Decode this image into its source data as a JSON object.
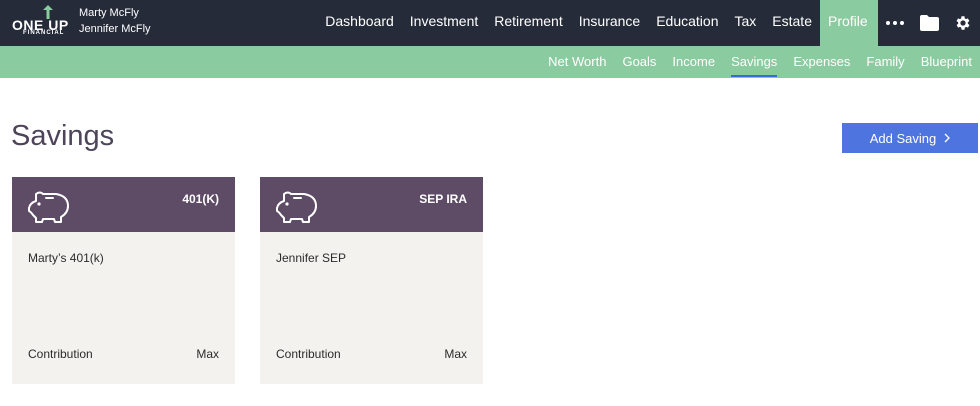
{
  "brand": {
    "logo_top": "ONE UP",
    "logo_bottom": "FINANCIAL"
  },
  "clients": [
    "Marty McFly",
    "Jennifer McFly"
  ],
  "main_nav": [
    {
      "label": "Dashboard"
    },
    {
      "label": "Investment"
    },
    {
      "label": "Retirement"
    },
    {
      "label": "Insurance"
    },
    {
      "label": "Education"
    },
    {
      "label": "Tax"
    },
    {
      "label": "Estate"
    },
    {
      "label": "Profile",
      "active": true
    }
  ],
  "nav_icons": [
    "more-icon",
    "folder-icon",
    "gear-icon"
  ],
  "sub_nav": [
    {
      "label": "Net Worth"
    },
    {
      "label": "Goals"
    },
    {
      "label": "Income"
    },
    {
      "label": "Savings",
      "active": true
    },
    {
      "label": "Expenses"
    },
    {
      "label": "Family"
    },
    {
      "label": "Blueprint"
    }
  ],
  "page": {
    "title": "Savings",
    "add_button": "Add Saving",
    "add_button_icon": "chevron-right-icon"
  },
  "cards": [
    {
      "icon": "piggy-bank-icon",
      "type": "401(K)",
      "name": "Marty’s 401(k)",
      "footer_label": "Contribution",
      "footer_value": "Max"
    },
    {
      "icon": "piggy-bank-icon",
      "type": "SEP IRA",
      "name": "Jennifer SEP",
      "footer_label": "Contribution",
      "footer_value": "Max"
    }
  ],
  "colors": {
    "topbar": "#262b3a",
    "accent_green": "#8acb9f",
    "card_header": "#5e4c66",
    "card_body": "#f4f2ee",
    "primary_button": "#4e74e0",
    "title_text": "#4d4459",
    "active_underline": "#3c68d9"
  }
}
